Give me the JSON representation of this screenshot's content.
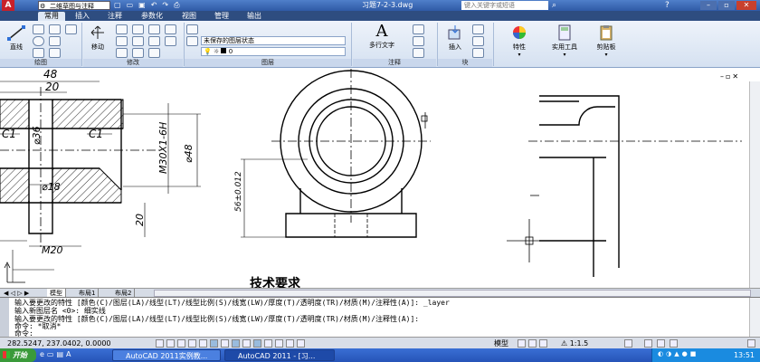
{
  "titlebar": {
    "workspace": "二维草图与注释",
    "filename": "习题7-2-3.dwg",
    "search_placeholder": "键入关键字或短语"
  },
  "ribbon_tabs": [
    "常用",
    "插入",
    "注释",
    "参数化",
    "视图",
    "管理",
    "输出"
  ],
  "ribbon": {
    "draw_panel": "绘图",
    "line": "直线",
    "modify_panel": "修改",
    "move": "移动",
    "layers_panel": "图层",
    "layer_state": "未保存的图层状态",
    "layer_current": "0",
    "annotation_panel": "注释",
    "mtext": "多行文字",
    "block_panel": "块",
    "insert": "插入",
    "properties": "特性",
    "utilities": "实用工具",
    "clipboard": "剪贴板"
  },
  "drawing": {
    "dim_48": "48",
    "dim_20": "20",
    "c1_left": "C1",
    "c1_right": "C1",
    "dia_36": "⌀36",
    "dia_18": "⌀18",
    "m30": "M30X1-6H",
    "dia_48": "⌀48",
    "dim_20_v": "20",
    "m20": "M20",
    "tol": "56±0.012",
    "tech_req": "技术要求"
  },
  "layout_tabs": [
    "模型",
    "布局1",
    "布局2"
  ],
  "command": {
    "line1": "输入要更改的特性 [颜色(C)/图层(LA)/线型(LT)/线型比例(S)/线宽(LW)/厚度(T)/透明度(TR)/材质(M)/注释性(A)]: _layer",
    "line2": "输入新图层名 <0>: 细实线",
    "line3": "输入要更改的特性 [颜色(C)/图层(LA)/线型(LT)/线型比例(S)/线宽(LW)/厚度(T)/透明度(TR)/材质(M)/注释性(A)]:",
    "line4": "命令: *取消*",
    "prompt": "命令:"
  },
  "status": {
    "coords": "282.5247, 237.0402, 0.0000",
    "model": "模型",
    "scale": "1:1.5"
  },
  "taskbar": {
    "start": "开始",
    "task1": "AutoCAD 2011实例教...",
    "task2": "AutoCAD 2011 - [习...",
    "clock": "13:51"
  }
}
